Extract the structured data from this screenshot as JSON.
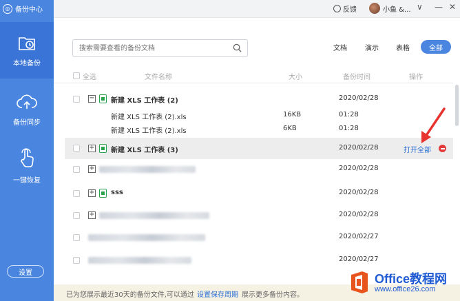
{
  "app": {
    "title": "备份中心"
  },
  "sidebar": {
    "items": [
      {
        "label": "本地备份",
        "icon": "folder-clock-icon",
        "active": true
      },
      {
        "label": "备份同步",
        "icon": "cloud-upload-icon",
        "active": false
      },
      {
        "label": "一键恢复",
        "icon": "hand-pointer-icon",
        "active": false
      }
    ],
    "settings_label": "设置"
  },
  "topbar": {
    "feedback_label": "反馈",
    "user_name": "小鱼 &...",
    "controls": [
      "∨",
      "—",
      "✕"
    ]
  },
  "search": {
    "placeholder": "搜索需要查看的备份文档"
  },
  "filters": {
    "doc": "文档",
    "ppt": "演示",
    "sheet": "表格",
    "all": "全部"
  },
  "table": {
    "headers": {
      "select_all": "全选",
      "name": "文件名称",
      "size": "大小",
      "time": "备份时间",
      "action": "操作"
    },
    "rows": [
      {
        "type": "group",
        "name": "新建 XLS 工作表 (2)",
        "date": "2020/02/28",
        "expanded": true
      },
      {
        "type": "child",
        "name": "新建 XLS 工作表 (2).xls",
        "size": "16KB",
        "time": "01:28"
      },
      {
        "type": "child",
        "name": "新建 XLS 工作表 (2).xls",
        "size": "6KB",
        "time": "01:28"
      },
      {
        "type": "group",
        "name": "新建 XLS 工作表 (3)",
        "date": "2020/02/28",
        "action": "打开全部",
        "highlight": true
      },
      {
        "type": "blurred",
        "date": "2020/02/28"
      },
      {
        "type": "group",
        "name": "sss",
        "date": "2020/02/28"
      },
      {
        "type": "blurred",
        "date": "2020/02/28"
      },
      {
        "type": "blurred",
        "date": "2020/02/27"
      },
      {
        "type": "blurred",
        "date": "2020/02/27"
      }
    ]
  },
  "footer": {
    "text_before": "已为您展示最近30天的备份文件,可以通过",
    "link": "设置保存周期",
    "text_after": "展示更多备份内容。"
  },
  "watermark": {
    "title": "Office教程网",
    "url": "www.office26.com"
  },
  "colors": {
    "sidebar": "#4a86e0",
    "accent": "#4a86e0",
    "link": "#2b6fd6",
    "delete": "#e23b3b",
    "arrow": "#e8322e"
  }
}
